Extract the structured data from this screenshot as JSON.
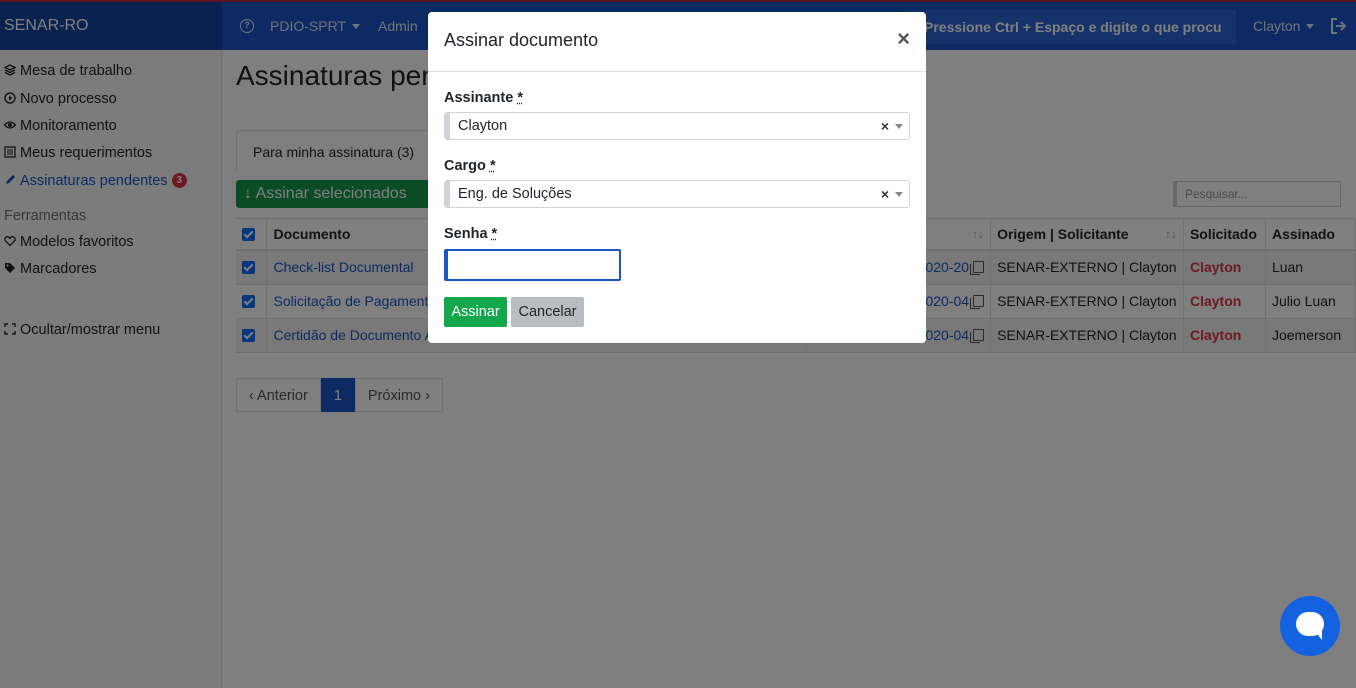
{
  "topbar": {
    "brand": "SENAR-RO",
    "nav_org": "PDIO-SPRT",
    "nav_admin": "Admin",
    "search_hint": "Pressione Ctrl + Espaço e digite o que procu",
    "user": "Clayton"
  },
  "sidebar": {
    "items": [
      {
        "label": "Mesa de trabalho",
        "icon": "layers-icon"
      },
      {
        "label": "Novo processo",
        "icon": "play-circle-icon"
      },
      {
        "label": "Monitoramento",
        "icon": "eye-icon"
      },
      {
        "label": "Meus requerimentos",
        "icon": "list-icon"
      },
      {
        "label": "Assinaturas pendentes",
        "icon": "pen-icon",
        "badge": "3"
      }
    ],
    "tools_header": "Ferramentas",
    "tools": [
      {
        "label": "Modelos favoritos",
        "icon": "heart-icon"
      },
      {
        "label": "Marcadores",
        "icon": "tags-icon"
      }
    ],
    "toggle_menu": "Ocultar/mostrar menu"
  },
  "main": {
    "title": "Assinaturas pendentes",
    "tab_label": "Para minha assinatura (3)",
    "sign_selected": "↓ Assinar selecionados",
    "search_placeholder": "Pesquisar...",
    "columns": {
      "documento": "Documento",
      "origem": "Origem | Solicitante",
      "solicitado": "Solicitado",
      "assinado": "Assinado"
    },
    "rows": [
      {
        "documento": "Check-list Documental",
        "codigo": "0395.000704/2020-20",
        "origem": "SENAR-EXTERNO | Clayton",
        "solicitado": "Clayton",
        "assinado": "Luan"
      },
      {
        "documento": "Solicitação de Pagamento",
        "codigo": "0395.000704/2020-04",
        "origem": "SENAR-EXTERNO | Clayton",
        "solicitado": "Clayton",
        "assinado": "Julio Luan"
      },
      {
        "documento": "Certidão de Documento Anexado (A-131B6)",
        "codigo": "0395.000704/2020-04",
        "origem": "SENAR-EXTERNO | Clayton",
        "solicitado": "Clayton",
        "assinado": "Joemerson"
      }
    ],
    "pagination": {
      "prev": "‹ Anterior",
      "current": "1",
      "next": "Próximo ›"
    }
  },
  "modal": {
    "title": "Assinar documento",
    "close": "×",
    "assinante_label": "Assinante",
    "assinante_value": "Clayton",
    "cargo_label": "Cargo",
    "cargo_value": "Eng. de Soluções",
    "senha_label": "Senha",
    "required_mark": "*",
    "senha_value": "",
    "btn_assinar": "Assinar",
    "btn_cancelar": "Cancelar",
    "clear_mark": "×"
  },
  "colors": {
    "primary": "#1b56c4",
    "success": "#13a84c",
    "danger": "#dc3545"
  }
}
